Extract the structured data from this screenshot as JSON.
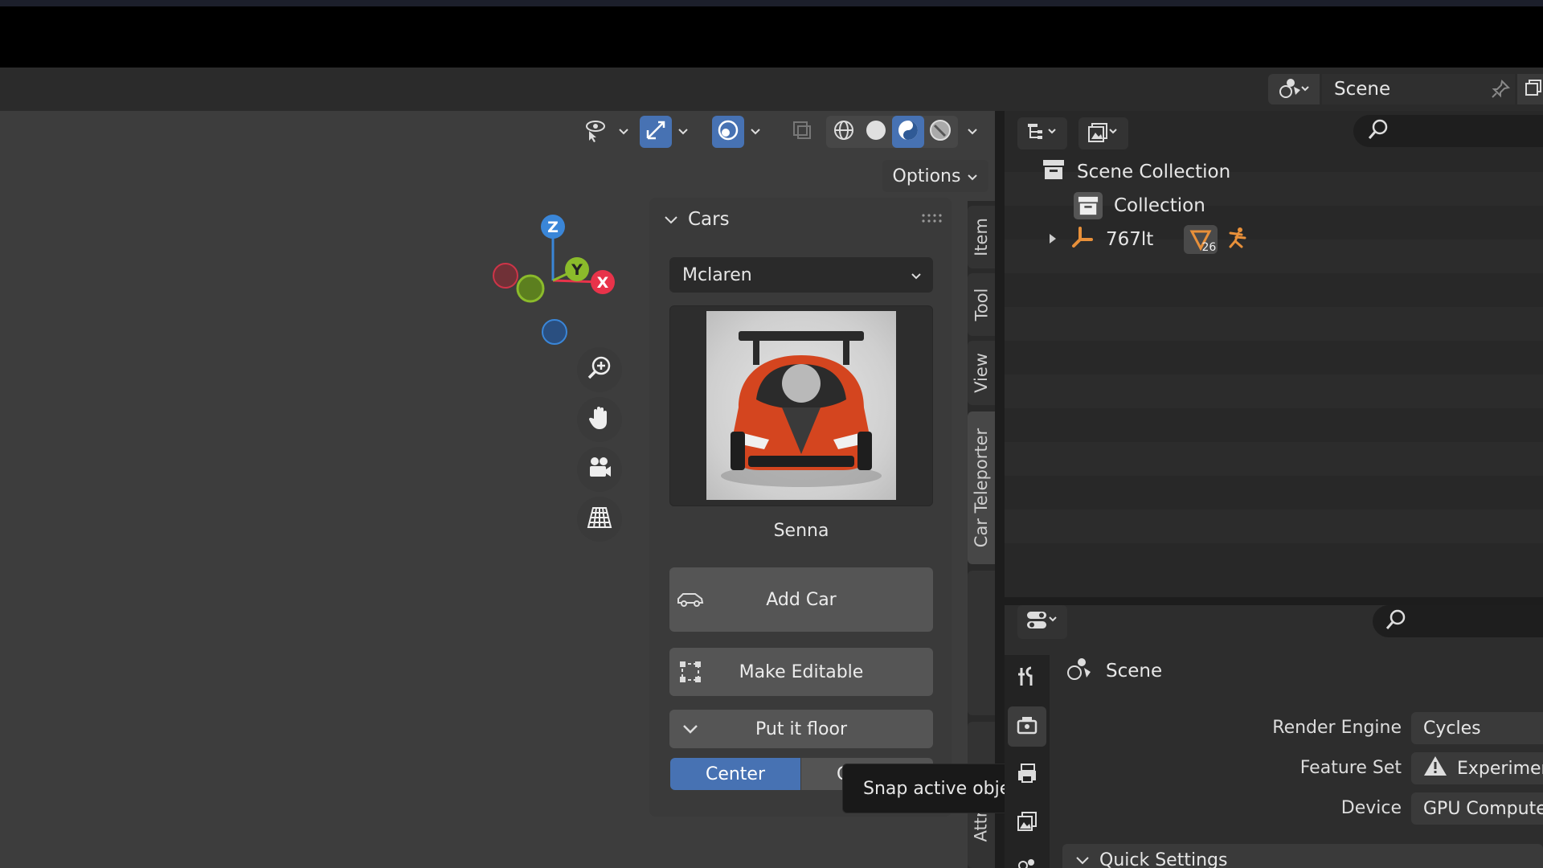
{
  "header": {
    "scene_name": "Scene"
  },
  "viewport": {
    "options_label": "Options",
    "gizmo": {
      "z": "Z",
      "y": "Y",
      "x": "X"
    }
  },
  "npanel": {
    "title": "Cars",
    "brand_selected": "Mclaren",
    "car_name": "Senna",
    "add_car_label": "Add Car",
    "make_editable_label": "Make Editable",
    "put_floor_label": "Put it floor",
    "center_label": "Center",
    "other_label": "C"
  },
  "tabs": {
    "item": "Item",
    "tool": "Tool",
    "view": "View",
    "car_teleporter": "Car Teleporter",
    "attr": "Attr"
  },
  "tooltip": {
    "text": "Snap active object to ground."
  },
  "outliner": {
    "scene_collection": "Scene Collection",
    "collection": "Collection",
    "object_name": "767lt",
    "badge_count": "26"
  },
  "properties": {
    "context": "Scene",
    "render_engine_label": "Render Engine",
    "render_engine_value": "Cycles",
    "feature_set_label": "Feature Set",
    "feature_set_value": "Experimental",
    "device_label": "Device",
    "device_value": "GPU Compute",
    "quick_settings": "Quick Settings"
  },
  "colors": {
    "accent": "#4772b3",
    "axis_x": "#e8334a",
    "axis_y": "#8bbb2b",
    "axis_z": "#3a86d8",
    "object_orange": "#e8903a"
  }
}
